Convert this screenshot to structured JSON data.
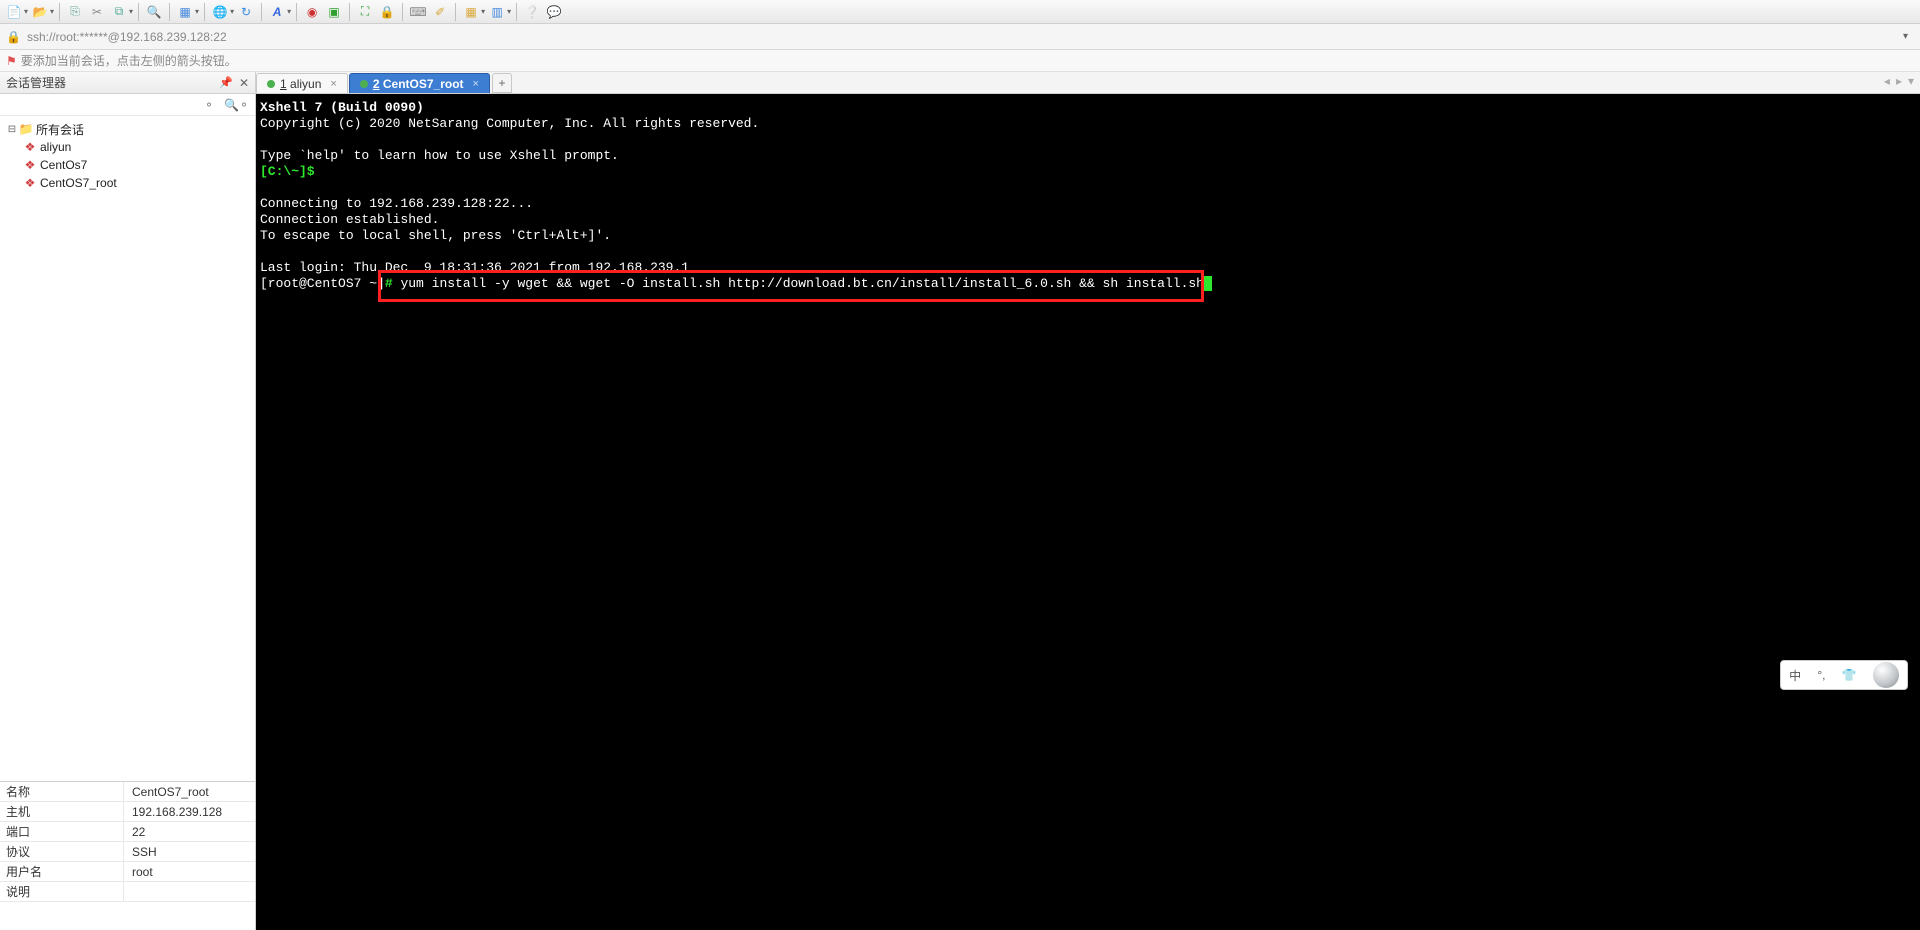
{
  "toolbar_icons": [
    "new",
    "open",
    "copy",
    "cut",
    "props",
    "search",
    "layout",
    "globe",
    "reconnect",
    "font",
    "sep",
    "rec",
    "play",
    "sep",
    "fullscreen",
    "lock",
    "keyb",
    "highlight",
    "add",
    "cols",
    "sep",
    "help",
    "chat"
  ],
  "addressbar": {
    "url": "ssh://root:******@192.168.239.128:22"
  },
  "hint": {
    "text": "要添加当前会话，点击左侧的箭头按钮。"
  },
  "session_panel": {
    "title": "会话管理器",
    "root": "所有会话",
    "items": [
      "aliyun",
      "CentOs7",
      "CentOS7_root"
    ]
  },
  "props": [
    {
      "k": "名称",
      "v": "CentOS7_root"
    },
    {
      "k": "主机",
      "v": "192.168.239.128"
    },
    {
      "k": "端口",
      "v": "22"
    },
    {
      "k": "协议",
      "v": "SSH"
    },
    {
      "k": "用户名",
      "v": "root"
    },
    {
      "k": "说明",
      "v": ""
    }
  ],
  "tabs": [
    {
      "num": "1",
      "label": "aliyun",
      "active": false,
      "dot": "green"
    },
    {
      "num": "2",
      "label": "CentOS7_root",
      "active": true,
      "dot": "green"
    }
  ],
  "terminal": {
    "line1": "Xshell 7 (Build 0090)",
    "line2": "Copyright (c) 2020 NetSarang Computer, Inc. All rights reserved.",
    "line3": "",
    "line4": "Type `help' to learn how to use Xshell prompt.",
    "prompt1": "[C:\\~]$",
    "line6": "",
    "line7": "Connecting to 192.168.239.128:22...",
    "line8": "Connection established.",
    "line9": "To escape to local shell, press 'Ctrl+Alt+]'.",
    "line10": "",
    "line11": "Last login: Thu Dec  9 18:31:36 2021 from 192.168.239.1",
    "prompt2_pre": "[root@CentOS7 ~]",
    "prompt2_hash": "#",
    "cmd": " yum install -y wget && wget -O install.sh http://download.bt.cn/install/install_6.0.sh && sh install.sh"
  },
  "ime": {
    "lang": "中",
    "punct": "°,",
    "shirt": "👕"
  }
}
